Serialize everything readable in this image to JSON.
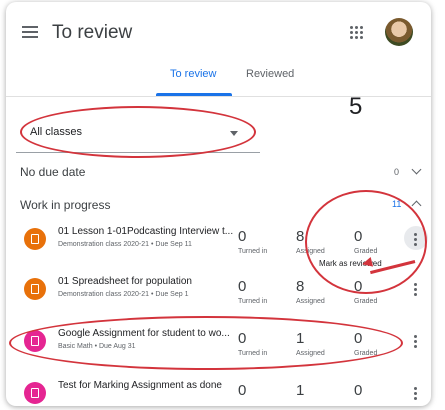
{
  "header": {
    "title": "To review"
  },
  "tabs": [
    {
      "label": "To review",
      "active": true
    },
    {
      "label": "Reviewed",
      "active": false
    }
  ],
  "annotation_number": "5",
  "class_filter": {
    "value": "All classes"
  },
  "sections": {
    "no_due": {
      "label": "No due date",
      "count": "0"
    },
    "in_progress": {
      "label": "Work in progress",
      "count": "11"
    }
  },
  "stat_labels": {
    "turned_in": "Turned in",
    "assigned": "Assigned",
    "graded": "Graded"
  },
  "rows": [
    {
      "title": "01 Lesson 1-01Podcasting Interview t...",
      "subtitle": "Demonstration class 2020-21 • Due Sep 11",
      "turned_in": "0",
      "assigned": "8",
      "graded": "0",
      "icon_color": "#e8710a"
    },
    {
      "title": "01 Spreadsheet for population",
      "subtitle": "Demonstration class 2020-21 • Due Sep 1",
      "turned_in": "0",
      "assigned": "8",
      "graded": "0",
      "icon_color": "#e8710a"
    },
    {
      "title": "Google Assignment for student to wo...",
      "subtitle": "Basic Math • Due Aug 31",
      "turned_in": "0",
      "assigned": "1",
      "graded": "0",
      "icon_color": "#e52592"
    },
    {
      "title": "Test for Marking Assignment as done",
      "subtitle": "",
      "turned_in": "0",
      "assigned": "1",
      "graded": "0",
      "icon_color": "#e52592"
    }
  ],
  "context_menu": {
    "item": "Mark as reviewed"
  },
  "colors": {
    "accent": "#1a73e8",
    "annotation_red": "#d3343c"
  },
  "icons": [
    "menu-icon",
    "apps-grid-icon",
    "assignment-icon",
    "more-vert-icon",
    "chevron-down-icon",
    "chevron-up-icon"
  ]
}
